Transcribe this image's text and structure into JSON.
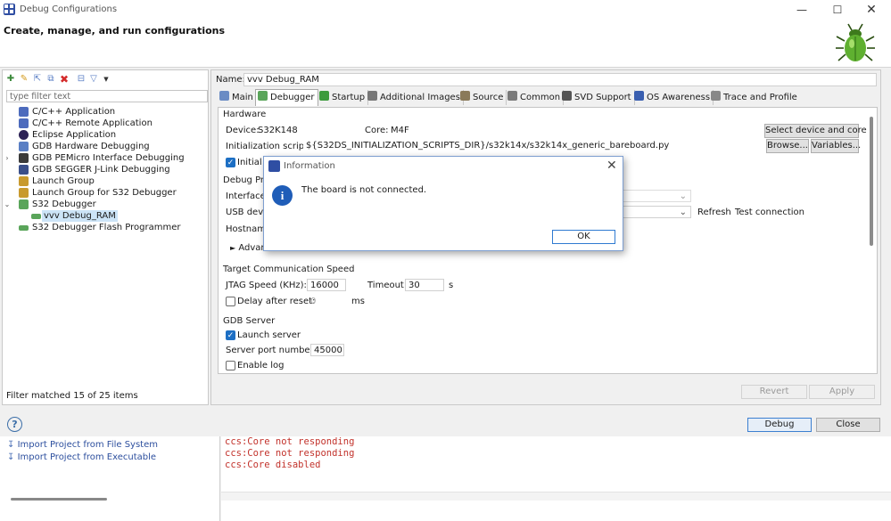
{
  "window": {
    "title": "Debug Configurations",
    "header": "Create, manage, and run configurations"
  },
  "left": {
    "filter_placeholder": "type filter text",
    "tree": [
      {
        "label": "C/C++ Application",
        "icon": "c-app-icon",
        "color": "#4d6bbd"
      },
      {
        "label": "C/C++ Remote Application",
        "icon": "c-remote-icon",
        "color": "#4d6bbd"
      },
      {
        "label": "Eclipse Application",
        "icon": "eclipse-icon",
        "color": "#2c2255"
      },
      {
        "label": "GDB Hardware Debugging",
        "icon": "gdb-hw-icon",
        "color": "#5a7fc4"
      },
      {
        "label": "GDB PEMicro Interface Debugging",
        "icon": "pemicro-icon",
        "color": "#3a3a3a"
      },
      {
        "label": "GDB SEGGER J-Link Debugging",
        "icon": "segger-icon",
        "color": "#3a4f8a"
      },
      {
        "label": "Launch Group",
        "icon": "launch-group-icon",
        "color": "#c89a2e"
      },
      {
        "label": "Launch Group for S32 Debugger",
        "icon": "launch-group-s32-icon",
        "color": "#c89a2e"
      },
      {
        "label": "S32 Debugger",
        "icon": "s32-debugger-icon",
        "color": "#5aa55a"
      },
      {
        "label": "vvv Debug_RAM",
        "icon": "config-icon",
        "color": "#5aa55a"
      },
      {
        "label": "S32 Debugger Flash Programmer",
        "icon": "flash-programmer-icon",
        "color": "#5aa55a"
      }
    ],
    "filter_status": "Filter matched 15 of 25 items"
  },
  "config": {
    "name_label": "Name:",
    "name_value": "vvv Debug_RAM",
    "tabs": [
      {
        "label": "Main",
        "icon": "main-tab-icon",
        "color": "#6b8cc4"
      },
      {
        "label": "Debugger",
        "icon": "debugger-tab-icon",
        "color": "#5aa55a"
      },
      {
        "label": "Startup",
        "icon": "startup-tab-icon",
        "color": "#3d9b3d"
      },
      {
        "label": "Additional Images",
        "icon": "images-tab-icon",
        "color": "#777777"
      },
      {
        "label": "Source",
        "icon": "source-tab-icon",
        "color": "#8a7a5a"
      },
      {
        "label": "Common",
        "icon": "common-tab-icon",
        "color": "#7a7a7a"
      },
      {
        "label": "SVD Support",
        "icon": "svd-tab-icon",
        "color": "#555555"
      },
      {
        "label": "OS Awareness",
        "icon": "os-tab-icon",
        "color": "#3a5fb0"
      },
      {
        "label": "Trace and Profile",
        "icon": "trace-tab-icon",
        "color": "#888888"
      }
    ],
    "hardware": {
      "title": "Hardware",
      "device_label": "Device:",
      "device_value": "S32K148",
      "core_label": "Core:",
      "core_value": "M4F",
      "select_button": "Select device and core",
      "init_label": "Initialization script:",
      "init_value": "${S32DS_INITIALIZATION_SCRIPTS_DIR}/s32k14x/s32k14x_generic_bareboard.py",
      "browse_button": "Browse...",
      "variables_button": "Variables...",
      "initial_label": "Initial c"
    },
    "debug_probe": {
      "title": "Debug Pro",
      "interface_label": "Interface:",
      "usb_label": "USB devic",
      "refresh_button": "Refresh",
      "test_button": "Test connection",
      "hostname_label": "Hostname",
      "advanced_label": "Advan"
    },
    "tcs": {
      "title": "Target Communication Speed",
      "jtag_label": "JTAG Speed (KHz):",
      "jtag_value": "16000",
      "timeout_label": "Timeout:",
      "timeout_value": "30",
      "timeout_unit": "s",
      "delay_label": "Delay after reset:",
      "delay_value": "0",
      "delay_unit": "ms"
    },
    "gdb": {
      "title": "GDB Server",
      "launch_label": "Launch server",
      "port_label": "Server port number:",
      "port_value": "45000",
      "log_label": "Enable log"
    },
    "revert_button": "Revert",
    "apply_button": "Apply"
  },
  "footer": {
    "debug_button": "Debug",
    "close_button": "Close"
  },
  "dialog": {
    "title": "Information",
    "message": "The board is not connected.",
    "ok_button": "OK"
  },
  "background": {
    "links": [
      "Import Project from File System",
      "Import Project from Executable"
    ],
    "console": [
      "ccs:Core not responding",
      "ccs:Core not responding",
      "ccs:Core disabled"
    ]
  }
}
